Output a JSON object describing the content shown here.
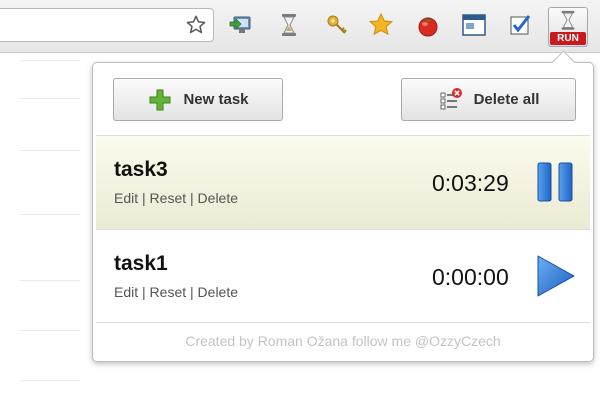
{
  "toolbar": {
    "extensions": [
      "monitor-arrow-icon",
      "hourglass-icon",
      "key-icon",
      "star-icon",
      "tomato-icon",
      "window-icon",
      "checkbox-icon",
      "timer-run-icon"
    ],
    "run_badge": "RUN"
  },
  "popup": {
    "new_task_label": "New task",
    "delete_all_label": "Delete all",
    "tasks": [
      {
        "name": "task3",
        "time": "0:03:29",
        "state": "running",
        "edit": "Edit",
        "reset": "Reset",
        "delete": "Delete"
      },
      {
        "name": "task1",
        "time": "0:00:00",
        "state": "stopped",
        "edit": "Edit",
        "reset": "Reset",
        "delete": "Delete"
      }
    ],
    "footer": "Created by Roman Ožana follow me @OzzyCzech"
  },
  "colors": {
    "running_bg": "#ecead3",
    "accent_blue": "#2b78d6",
    "plus_green": "#5fae2e",
    "run_red": "#c81a1a"
  }
}
